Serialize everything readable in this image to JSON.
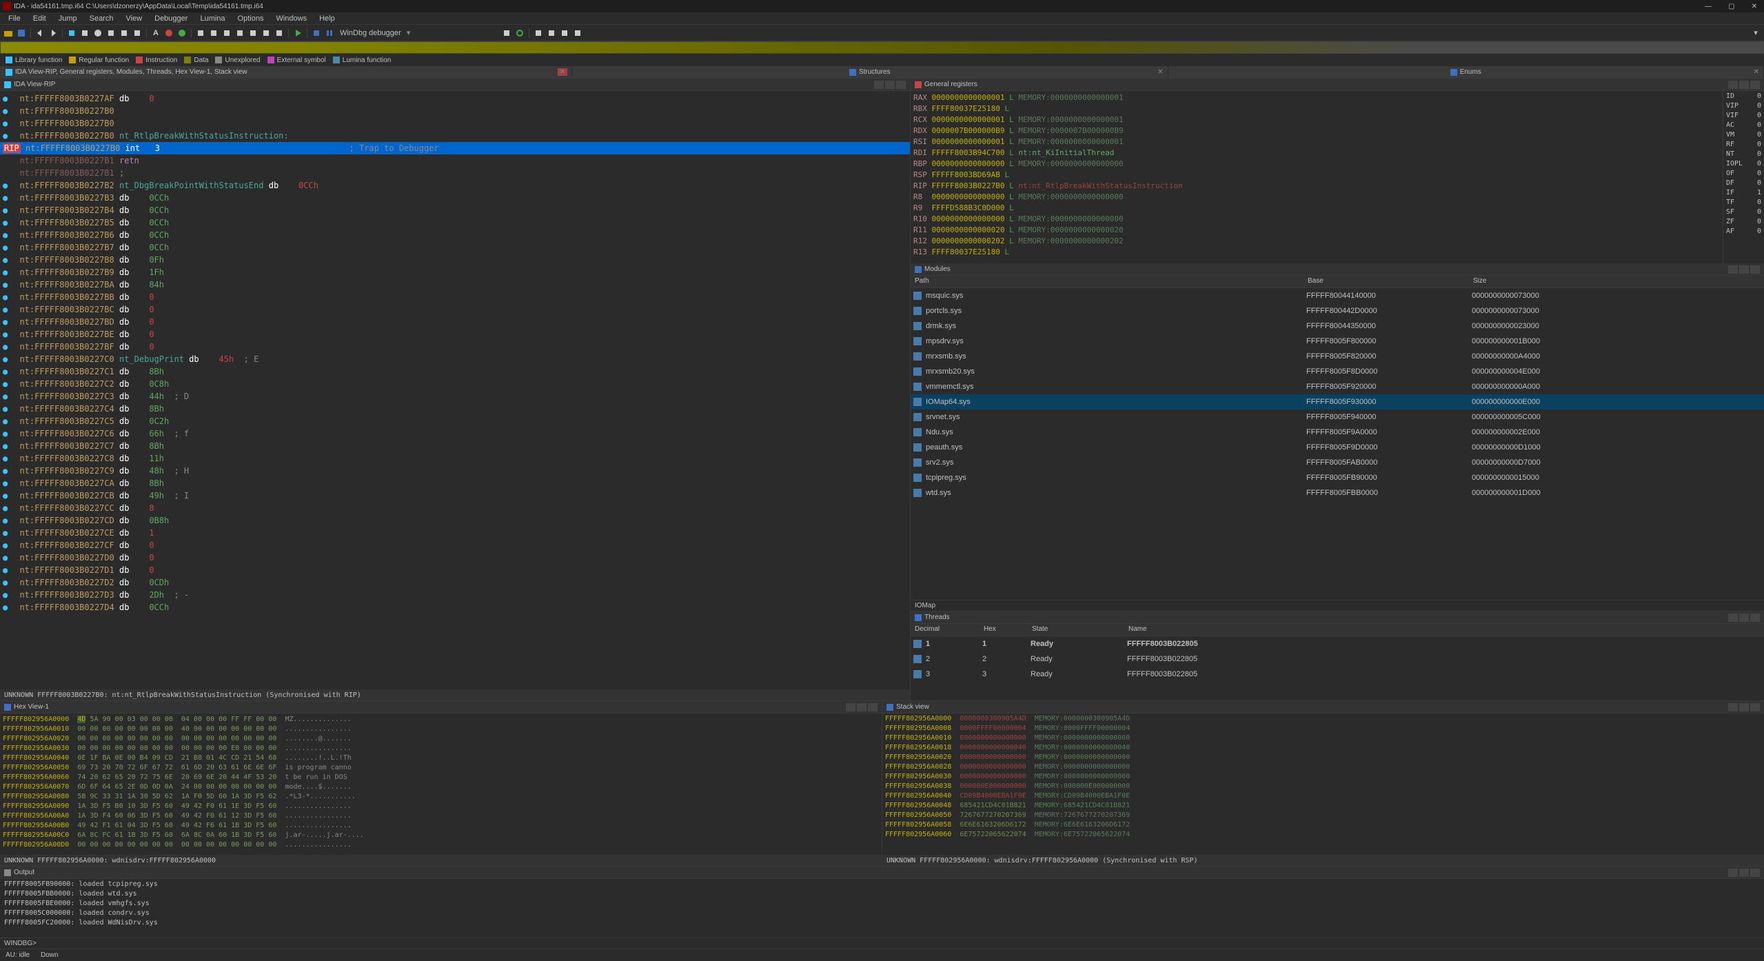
{
  "window": {
    "title": "IDA - ida54161.tmp.i64 C:\\Users\\dzonerzy\\AppData\\Local\\Temp\\ida54161.tmp.i64",
    "min": "—",
    "max": "▢",
    "close": "✕"
  },
  "menu": [
    "File",
    "Edit",
    "Jump",
    "Search",
    "View",
    "Debugger",
    "Lumina",
    "Options",
    "Windows",
    "Help"
  ],
  "toolbar": {
    "debugger": "WinDbg debugger"
  },
  "legend": [
    {
      "color": "#3ac4ff",
      "label": "Library function"
    },
    {
      "color": "#c4a000",
      "label": "Regular function"
    },
    {
      "color": "#c44",
      "label": "Instruction"
    },
    {
      "color": "#808000",
      "label": "Data"
    },
    {
      "color": "#888",
      "label": "Unexplored"
    },
    {
      "color": "#c040c0",
      "label": "External symbol"
    },
    {
      "color": "#4a8aaa",
      "label": "Lumina function"
    }
  ],
  "tabs": {
    "t1": "IDA View-RIP, General registers, Modules, Threads, Hex View-1, Stack view",
    "t2": "Structures",
    "t3": "Enums"
  },
  "idaview": {
    "title": "IDA View-RIP",
    "lines": [
      {
        "dot": "●",
        "addr": "nt:FFFFF8003B0227AF",
        "op": "db",
        "val": "0",
        "vc": "val-red"
      },
      {
        "dot": "●",
        "addr": "nt:FFFFF8003B0227B0",
        "op": "",
        "val": ""
      },
      {
        "dot": "●",
        "addr": "nt:FFFFF8003B0227B0",
        "op": "",
        "val": ""
      },
      {
        "dot": "●",
        "addr": "nt:FFFFF8003B0227B0",
        "label": "nt_RtlpBreakWithStatusInstruction:",
        "lc": "txt-teal"
      },
      {
        "hl": true,
        "rip": "RIP",
        "addr": "nt:FFFFF8003B0227B0",
        "op": "int",
        "val": "3",
        "cmt": "; Trap to Debugger"
      },
      {
        "dot": "",
        "addr": "nt:FFFFF8003B0227B1",
        "ac": "addr-dim",
        "op": "retn",
        "oc": "txt-purple"
      },
      {
        "dot": "",
        "addr": "nt:FFFFF8003B0227B1",
        "ac": "addr-dim",
        "op": ";",
        "oc": "cmt"
      },
      {
        "dot": "●",
        "addr": "nt:FFFFF8003B0227B2",
        "label": "nt_DbgBreakPointWithStatusEnd",
        "lc": "txt-teal",
        "op": "db",
        "val": "0CCh",
        "vc": "val-red"
      },
      {
        "dot": "●",
        "addr": "nt:FFFFF8003B0227B3",
        "op": "db",
        "val": "0CCh",
        "vc": "val-green"
      },
      {
        "dot": "●",
        "addr": "nt:FFFFF8003B0227B4",
        "op": "db",
        "val": "0CCh",
        "vc": "val-green"
      },
      {
        "dot": "●",
        "addr": "nt:FFFFF8003B0227B5",
        "op": "db",
        "val": "0CCh",
        "vc": "val-green"
      },
      {
        "dot": "●",
        "addr": "nt:FFFFF8003B0227B6",
        "op": "db",
        "val": "0CCh",
        "vc": "val-green"
      },
      {
        "dot": "●",
        "addr": "nt:FFFFF8003B0227B7",
        "op": "db",
        "val": "0CCh",
        "vc": "val-green"
      },
      {
        "dot": "●",
        "addr": "nt:FFFFF8003B0227B8",
        "op": "db",
        "val": "0Fh",
        "vc": "val-green"
      },
      {
        "dot": "●",
        "addr": "nt:FFFFF8003B0227B9",
        "op": "db",
        "val": "1Fh",
        "vc": "val-green"
      },
      {
        "dot": "●",
        "addr": "nt:FFFFF8003B0227BA",
        "op": "db",
        "val": "84h",
        "vc": "val-green"
      },
      {
        "dot": "●",
        "addr": "nt:FFFFF8003B0227BB",
        "op": "db",
        "val": "0",
        "vc": "val-red"
      },
      {
        "dot": "●",
        "addr": "nt:FFFFF8003B0227BC",
        "op": "db",
        "val": "0",
        "vc": "val-red"
      },
      {
        "dot": "●",
        "addr": "nt:FFFFF8003B0227BD",
        "op": "db",
        "val": "0",
        "vc": "val-red"
      },
      {
        "dot": "●",
        "addr": "nt:FFFFF8003B0227BE",
        "op": "db",
        "val": "0",
        "vc": "val-red"
      },
      {
        "dot": "●",
        "addr": "nt:FFFFF8003B0227BF",
        "op": "db",
        "val": "0",
        "vc": "val-red"
      },
      {
        "dot": "●",
        "addr": "nt:FFFFF8003B0227C0",
        "label": "nt_DebugPrint",
        "lc": "txt-teal",
        "op": "db",
        "val": "45h",
        "vc": "val-red",
        "cmt": "; E"
      },
      {
        "dot": "●",
        "addr": "nt:FFFFF8003B0227C1",
        "op": "db",
        "val": "8Bh",
        "vc": "val-green"
      },
      {
        "dot": "●",
        "addr": "nt:FFFFF8003B0227C2",
        "op": "db",
        "val": "0C8h",
        "vc": "val-green"
      },
      {
        "dot": "●",
        "addr": "nt:FFFFF8003B0227C3",
        "op": "db",
        "val": "44h",
        "vc": "val-green",
        "cmt": "; D"
      },
      {
        "dot": "●",
        "addr": "nt:FFFFF8003B0227C4",
        "op": "db",
        "val": "8Bh",
        "vc": "val-green"
      },
      {
        "dot": "●",
        "addr": "nt:FFFFF8003B0227C5",
        "op": "db",
        "val": "0C2h",
        "vc": "val-green"
      },
      {
        "dot": "●",
        "addr": "nt:FFFFF8003B0227C6",
        "op": "db",
        "val": "66h",
        "vc": "val-green",
        "cmt": "; f"
      },
      {
        "dot": "●",
        "addr": "nt:FFFFF8003B0227C7",
        "op": "db",
        "val": "8Bh",
        "vc": "val-green"
      },
      {
        "dot": "●",
        "addr": "nt:FFFFF8003B0227C8",
        "op": "db",
        "val": "11h",
        "vc": "val-green"
      },
      {
        "dot": "●",
        "addr": "nt:FFFFF8003B0227C9",
        "op": "db",
        "val": "48h",
        "vc": "val-green",
        "cmt": "; H"
      },
      {
        "dot": "●",
        "addr": "nt:FFFFF8003B0227CA",
        "op": "db",
        "val": "8Bh",
        "vc": "val-green"
      },
      {
        "dot": "●",
        "addr": "nt:FFFFF8003B0227CB",
        "op": "db",
        "val": "49h",
        "vc": "val-green",
        "cmt": "; I"
      },
      {
        "dot": "●",
        "addr": "nt:FFFFF8003B0227CC",
        "op": "db",
        "val": "8",
        "vc": "val-red"
      },
      {
        "dot": "●",
        "addr": "nt:FFFFF8003B0227CD",
        "op": "db",
        "val": "0B8h",
        "vc": "val-green"
      },
      {
        "dot": "●",
        "addr": "nt:FFFFF8003B0227CE",
        "op": "db",
        "val": "1",
        "vc": "val-red"
      },
      {
        "dot": "●",
        "addr": "nt:FFFFF8003B0227CF",
        "op": "db",
        "val": "0",
        "vc": "val-red"
      },
      {
        "dot": "●",
        "addr": "nt:FFFFF8003B0227D0",
        "op": "db",
        "val": "0",
        "vc": "val-red"
      },
      {
        "dot": "●",
        "addr": "nt:FFFFF8003B0227D1",
        "op": "db",
        "val": "0",
        "vc": "val-red"
      },
      {
        "dot": "●",
        "addr": "nt:FFFFF8003B0227D2",
        "op": "db",
        "val": "0CDh",
        "vc": "val-green"
      },
      {
        "dot": "●",
        "addr": "nt:FFFFF8003B0227D3",
        "op": "db",
        "val": "2Dh",
        "vc": "val-green",
        "cmt": "; -"
      },
      {
        "dot": "●",
        "addr": "nt:FFFFF8003B0227D4",
        "op": "db",
        "val": "0CCh",
        "vc": "val-green"
      }
    ],
    "status": "UNKNOWN FFFFF8003B0227B0: nt:nt_RtlpBreakWithStatusInstruction (Synchronised with RIP)"
  },
  "registers": {
    "title": "General registers",
    "regs": [
      {
        "n": "RAX",
        "v": "0000000000000001",
        "l": "L",
        "mem": "MEMORY:0000000000000001",
        "mc": "reg-mem"
      },
      {
        "n": "RBX",
        "v": "FFFF80037E25180",
        "l": "L"
      },
      {
        "n": "RCX",
        "v": "0000000000000001",
        "l": "L",
        "mem": "MEMORY:0000000000000001",
        "mc": "reg-mem"
      },
      {
        "n": "RDX",
        "v": "0000007B000000B9",
        "l": "L",
        "mem": "MEMORY:0000007B000000B9",
        "mc": "reg-mem"
      },
      {
        "n": "RSI",
        "v": "0000000000000001",
        "l": "L",
        "mem": "MEMORY:0000000000000001",
        "mc": "reg-mem"
      },
      {
        "n": "RDI",
        "v": "FFFFF8003B94C700",
        "l": "L",
        "mem": "nt:nt_KiInitialThread",
        "mc": "reg-val-g"
      },
      {
        "n": "RBP",
        "v": "0000000000000000",
        "l": "L",
        "mem": "MEMORY:0000000000000000",
        "mc": "reg-mem"
      },
      {
        "n": "RSP",
        "v": "FFFFF8003BD69AB",
        "l": "L"
      },
      {
        "n": "RIP",
        "v": "FFFFF8003B0227B0",
        "l": "L",
        "mem": "nt:nt_RtlpBreakWithStatusInstruction",
        "mc": "reg-mem-red",
        "pre": "L "
      },
      {
        "n": "R8",
        "v": "0000000000000000",
        "l": "L",
        "mem": "MEMORY:0000000000000000",
        "mc": "reg-mem"
      },
      {
        "n": "R9",
        "v": "FFFFD588B3C0D000",
        "l": "L"
      },
      {
        "n": "R10",
        "v": "0000000000000000",
        "l": "L",
        "mem": "MEMORY:0000000000000000",
        "mc": "reg-mem"
      },
      {
        "n": "R11",
        "v": "0000000000000020",
        "l": "L",
        "mem": "MEMORY:0000000000000020",
        "mc": "reg-mem"
      },
      {
        "n": "R12",
        "v": "0000000000000202",
        "l": "L",
        "mem": "MEMORY:0000000000000202",
        "mc": "reg-mem"
      },
      {
        "n": "R13",
        "v": "FFFF80037E25180",
        "l": "L"
      }
    ],
    "flags": [
      {
        "n": "ID",
        "v": "0"
      },
      {
        "n": "VIP",
        "v": "0"
      },
      {
        "n": "VIF",
        "v": "0"
      },
      {
        "n": "AC",
        "v": "0"
      },
      {
        "n": "VM",
        "v": "0"
      },
      {
        "n": "RF",
        "v": "0"
      },
      {
        "n": "NT",
        "v": "0"
      },
      {
        "n": "IOPL",
        "v": "0"
      },
      {
        "n": "OF",
        "v": "0"
      },
      {
        "n": "DF",
        "v": "0"
      },
      {
        "n": "IF",
        "v": "1"
      },
      {
        "n": "TF",
        "v": "0"
      },
      {
        "n": "SF",
        "v": "0"
      },
      {
        "n": "ZF",
        "v": "0"
      },
      {
        "n": "AF",
        "v": "0"
      }
    ]
  },
  "modules": {
    "title": "Modules",
    "cols": {
      "path": "Path",
      "base": "Base",
      "size": "Size"
    },
    "rows": [
      {
        "path": "msquic.sys",
        "base": "FFFFF80044140000",
        "size": "0000000000073000"
      },
      {
        "path": "portcls.sys",
        "base": "FFFFF800442D0000",
        "size": "0000000000073000"
      },
      {
        "path": "drmk.sys",
        "base": "FFFFF80044350000",
        "size": "0000000000023000"
      },
      {
        "path": "mpsdrv.sys",
        "base": "FFFFF8005F800000",
        "size": "000000000001B000"
      },
      {
        "path": "mrxsmb.sys",
        "base": "FFFFF8005F820000",
        "size": "00000000000A4000"
      },
      {
        "path": "mrxsmb20.sys",
        "base": "FFFFF8005F8D0000",
        "size": "000000000004E000"
      },
      {
        "path": "vmmemctl.sys",
        "base": "FFFFF8005F920000",
        "size": "000000000000A000"
      },
      {
        "path": "IOMap64.sys",
        "base": "FFFFF8005F930000",
        "size": "000000000000E000",
        "sel": true
      },
      {
        "path": "srvnet.sys",
        "base": "FFFFF8005F940000",
        "size": "000000000005C000"
      },
      {
        "path": "Ndu.sys",
        "base": "FFFFF8005F9A0000",
        "size": "000000000002E000"
      },
      {
        "path": "peauth.sys",
        "base": "FFFFF8005F9D0000",
        "size": "00000000000D1000"
      },
      {
        "path": "srv2.sys",
        "base": "FFFFF8005FAB0000",
        "size": "00000000000D7000"
      },
      {
        "path": "tcpipreg.sys",
        "base": "FFFFF8005FB90000",
        "size": "0000000000015000"
      },
      {
        "path": "wtd.sys",
        "base": "FFFFF8005FBB0000",
        "size": "000000000001D000"
      }
    ],
    "search": "IOMap"
  },
  "threads": {
    "title": "Threads",
    "cols": {
      "dec": "Decimal",
      "hex": "Hex",
      "state": "State",
      "name": "Name"
    },
    "rows": [
      {
        "dec": "1",
        "hex": "1",
        "state": "Ready",
        "name": "FFFFF8003B022805",
        "bold": true
      },
      {
        "dec": "2",
        "hex": "2",
        "state": "Ready",
        "name": "FFFFF8003B022805"
      },
      {
        "dec": "3",
        "hex": "3",
        "state": "Ready",
        "name": "FFFFF8003B022805"
      }
    ]
  },
  "hex": {
    "title": "Hex View-1",
    "lines": [
      {
        "a": "FFFFF802956A0000",
        "b1": "4D",
        "b": "5A 90 00 03 00 00 00  04 00 00 00 FF FF 00 00",
        "t": "MZ.............."
      },
      {
        "a": "FFFFF802956A0010",
        "b": "00 00 00 00 00 00 00 00  40 00 00 00 00 00 00 00",
        "t": "................"
      },
      {
        "a": "FFFFF802956A0020",
        "b": "00 00 00 00 00 00 00 00  00 00 00 00 00 00 00 00",
        "t": "........@......."
      },
      {
        "a": "FFFFF802956A0030",
        "b": "00 00 00 00 00 00 00 00  00 00 00 00 E0 00 00 00",
        "t": "................"
      },
      {
        "a": "FFFFF802956A0040",
        "b": "0E 1F BA 0E 00 B4 09 CD  21 B8 01 4C CD 21 54 68",
        "t": "........!..L.!Th"
      },
      {
        "a": "FFFFF802956A0050",
        "b": "69 73 20 70 72 6F 67 72  61 6D 20 63 61 6E 6E 6F",
        "t": "is program canno"
      },
      {
        "a": "FFFFF802956A0060",
        "b": "74 20 62 65 20 72 75 6E  20 69 6E 20 44 4F 53 20",
        "t": "t be run in DOS "
      },
      {
        "a": "FFFFF802956A0070",
        "b": "6D 6F 64 65 2E 0D 0D 0A  24 00 00 00 00 00 00 00",
        "t": "mode....$......."
      },
      {
        "a": "FFFFF802956A0080",
        "b": "5B 9C 33 31 1A 30 5D 62  1A F0 5D 60 1A 3D F5 62",
        "t": ".*L3-*..........."
      },
      {
        "a": "FFFFF802956A0090",
        "b": "1A 3D F5 B0 10 3D F5 60  49 42 F0 61 1E 3D F5 60",
        "t": "................"
      },
      {
        "a": "FFFFF802956A00A0",
        "b": "1A 3D F4 60 06 3D F5 60  49 42 F0 61 12 3D F5 60",
        "t": "................"
      },
      {
        "a": "FFFFF802956A00B0",
        "b": "49 42 F1 61 04 3D F5 60  49 42 F6 61 1B 3D F5 60",
        "t": "................"
      },
      {
        "a": "FFFFF802956A00C0",
        "b": "6A 8C FC 61 1B 3D F5 60  6A 8C 0A 60 1B 3D F5 60",
        "t": "j.ar-.....j.ar-...."
      },
      {
        "a": "FFFFF802956A00D0",
        "b": "00 00 00 00 00 00 00 00  00 00 00 00 00 00 00 00",
        "t": "................"
      }
    ],
    "status": "UNKNOWN FFFFF802956A0000: wdnisdrv:FFFFF802956A0000"
  },
  "stack": {
    "title": "Stack view",
    "lines": [
      {
        "a": "FFFFF802956A0000",
        "v": "0000000300905A4D",
        "mem": "MEMORY:0000000300905A4D",
        "vc": "stack-val-r"
      },
      {
        "a": "FFFFF802956A0008",
        "v": "0000FFFF00000004",
        "mem": "MEMORY:0000FFFF00000004",
        "vc": "stack-val-r"
      },
      {
        "a": "FFFFF802956A0010",
        "v": "0000000000000000",
        "mem": "MEMORY:0000000000000000",
        "vc": "stack-val-r"
      },
      {
        "a": "FFFFF802956A0018",
        "v": "0000000000000040",
        "mem": "MEMORY:0000000000000040",
        "vc": "stack-val-r"
      },
      {
        "a": "FFFFF802956A0020",
        "v": "0000000000000000",
        "mem": "MEMORY:0000000000000000",
        "vc": "stack-val-r"
      },
      {
        "a": "FFFFF802956A0028",
        "v": "0000000000000000",
        "mem": "MEMORY:0000000000000000",
        "vc": "stack-val-r"
      },
      {
        "a": "FFFFF802956A0030",
        "v": "0000000000000000",
        "mem": "MEMORY:0000000000000000",
        "vc": "stack-val-r"
      },
      {
        "a": "FFFFF802956A0038",
        "v": "000000E000000000",
        "mem": "MEMORY:000000E000000000",
        "vc": "stack-val-r"
      },
      {
        "a": "FFFFF802956A0040",
        "v": "CD09B4000EBA1F0E",
        "mem": "MEMORY:CD09B4000EBA1F0E",
        "vc": "stack-val-r"
      },
      {
        "a": "FFFFF802956A0048",
        "v": "685421CD4C01B821",
        "mem": "MEMORY:685421CD4C01B821",
        "vc": "stack-val-g"
      },
      {
        "a": "FFFFF802956A0050",
        "v": "7267677270207369",
        "mem": "MEMORY:7267677270207369",
        "vc": "stack-val-g"
      },
      {
        "a": "FFFFF802956A0058",
        "v": "6E6E6163206D6172",
        "mem": "MEMORY:6E6E6163206D6172",
        "vc": "stack-val-g"
      },
      {
        "a": "FFFFF802956A0060",
        "v": "6E75722065622074",
        "mem": "MEMORY:6E75722065622074",
        "vc": "stack-val-g"
      }
    ],
    "status": "UNKNOWN FFFFF802956A0000: wdnisdrv:FFFFF802956A0000 (Synchronised with RSP)"
  },
  "output": {
    "title": "Output",
    "lines": [
      "FFFFF8005FB90000: loaded tcpipreg.sys",
      "FFFFF8005FBB0000: loaded wtd.sys",
      "FFFFF8005FBE0000: loaded vmhgfs.sys",
      "FFFFF8005C000000: loaded condrv.sys",
      "FFFFF8005FC20000: loaded WdNisDrv.sys"
    ],
    "prompt": "WINDBG>"
  },
  "statusbar": {
    "au": "AU: idle",
    "down": "Down"
  }
}
